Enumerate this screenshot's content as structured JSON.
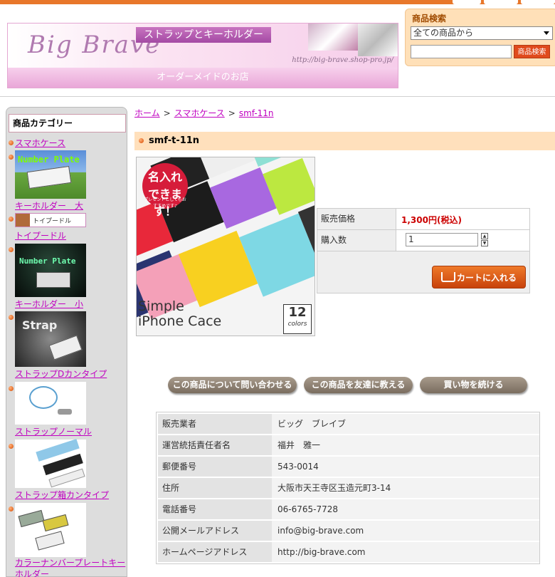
{
  "header": {
    "logo": "Big Brave",
    "banner_tag": "ストラップとキーホルダー",
    "banner_url": "http://big-brave.shop-pro.jp/",
    "banner_subtitle": "オーダーメイドのお店"
  },
  "search": {
    "title": "商品検索",
    "select_value": "全ての商品から",
    "input_value": "",
    "button": "商品検索"
  },
  "sidebar": {
    "title": "商品カテゴリー",
    "items": [
      {
        "label": "スマホケース"
      },
      {
        "label": "キーホルダー　大",
        "thumb": "Number Plate"
      },
      {
        "label": "トイプードル",
        "thumb": "トイプードル"
      },
      {
        "label": "キーホルダー　小",
        "thumb": "Number Plate"
      },
      {
        "label": "ストラップDカンタイプ",
        "thumb": "Strap"
      },
      {
        "label": "ストラップノーマル"
      },
      {
        "label": "ストラップ箱カンタイプ"
      },
      {
        "label": "カラーナンバープレートキーホルダー"
      }
    ]
  },
  "breadcrumb": [
    "ホーム",
    "スマホケース",
    "smf-11n"
  ],
  "product": {
    "title": "smf-t-11n",
    "image_badge": "名入れできます！",
    "image_badge_sub": "プレゼントとしてもおすすめです♪",
    "image_caption_1": "Simple",
    "image_caption_2": "iPhone Cace",
    "image_count": "12",
    "image_count_label": "colors",
    "price_label": "販売価格",
    "price": "1,300円(税込)",
    "qty_label": "購入数",
    "qty": "1",
    "cart_button": "カートに入れる"
  },
  "actions": {
    "inquiry": "この商品について問い合わせる",
    "tell_friend": "この商品を友達に教える",
    "continue": "買い物を続ける"
  },
  "seller_info": [
    {
      "k": "販売業者",
      "v": "ビッグ　ブレイブ"
    },
    {
      "k": "運営統括責任者名",
      "v": "福井　雅一"
    },
    {
      "k": "郵便番号",
      "v": "543-0014"
    },
    {
      "k": "住所",
      "v": "大阪市天王寺区玉造元町3-14"
    },
    {
      "k": "電話番号",
      "v": "06-6765-7728"
    },
    {
      "k": "公開メールアドレス",
      "v": "info@big-brave.com"
    },
    {
      "k": "ホームページアドレス",
      "v": "http://big-brave.com"
    }
  ]
}
